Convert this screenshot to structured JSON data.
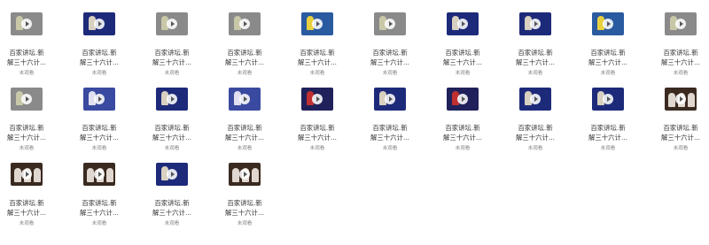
{
  "videos": [
    {
      "title_line1": "百家讲坛.新",
      "title_line2": "解三十六计...",
      "status": "未观看",
      "thumb": "gray"
    },
    {
      "title_line1": "百家讲坛.新",
      "title_line2": "解三十六计...",
      "status": "未观看",
      "thumb": "blue-stage"
    },
    {
      "title_line1": "百家讲坛.新",
      "title_line2": "解三十六计...",
      "status": "未观看",
      "thumb": "gray"
    },
    {
      "title_line1": "百家讲坛.新",
      "title_line2": "解三十六计...",
      "status": "未观看",
      "thumb": "gray"
    },
    {
      "title_line1": "百家讲坛.新",
      "title_line2": "解三十六计...",
      "status": "未观看",
      "thumb": "yellow-stage"
    },
    {
      "title_line1": "百家讲坛.新",
      "title_line2": "解三十六计...",
      "status": "未观看",
      "thumb": "gray"
    },
    {
      "title_line1": "百家讲坛.新",
      "title_line2": "解三十六计...",
      "status": "未观看",
      "thumb": "blue-stage"
    },
    {
      "title_line1": "百家讲坛.新",
      "title_line2": "解三十六计...",
      "status": "未观看",
      "thumb": "blue-stage"
    },
    {
      "title_line1": "百家讲坛.新",
      "title_line2": "解三十六计...",
      "status": "未观看",
      "thumb": "yellow-stage"
    },
    {
      "title_line1": "百家讲坛.新",
      "title_line2": "解三十六计...",
      "status": "未观看",
      "thumb": "gray"
    },
    {
      "title_line1": "百家讲坛.新",
      "title_line2": "解三十六计...",
      "status": "未观看",
      "thumb": "gray"
    },
    {
      "title_line1": "百家讲坛.新",
      "title_line2": "解三十六计...",
      "status": "未观看",
      "thumb": "pattern-stage"
    },
    {
      "title_line1": "百家讲坛.新",
      "title_line2": "解三十六计...",
      "status": "未观看",
      "thumb": "blue-stage"
    },
    {
      "title_line1": "百家讲坛.新",
      "title_line2": "解三十六计...",
      "status": "未观看",
      "thumb": "pattern-stage"
    },
    {
      "title_line1": "百家讲坛.新",
      "title_line2": "解三十六计...",
      "status": "未观看",
      "thumb": "dark-red-stage"
    },
    {
      "title_line1": "百家讲坛.新",
      "title_line2": "解三十六计...",
      "status": "未观看",
      "thumb": "blue-stage"
    },
    {
      "title_line1": "百家讲坛.新",
      "title_line2": "解三十六计...",
      "status": "未观看",
      "thumb": "dark-red-stage"
    },
    {
      "title_line1": "百家讲坛.新",
      "title_line2": "解三十六计...",
      "status": "未观看",
      "thumb": "blue-stage"
    },
    {
      "title_line1": "百家讲坛.新",
      "title_line2": "解三十六计...",
      "status": "未观看",
      "thumb": "blue-stage"
    },
    {
      "title_line1": "百家讲坛.新",
      "title_line2": "解三十六计...",
      "status": "未观看",
      "thumb": "audience"
    },
    {
      "title_line1": "百家讲坛.新",
      "title_line2": "解三十六计...",
      "status": "未观看",
      "thumb": "audience"
    },
    {
      "title_line1": "百家讲坛.新",
      "title_line2": "解三十六计...",
      "status": "未观看",
      "thumb": "audience"
    },
    {
      "title_line1": "百家讲坛.新",
      "title_line2": "解三十六计...",
      "status": "未观看",
      "thumb": "blue-stage"
    },
    {
      "title_line1": "百家讲坛.新",
      "title_line2": "解三十六计...",
      "status": "未观看",
      "thumb": "audience"
    }
  ],
  "thumb_styles": {
    "gray": {
      "bg": "#8a8a8a",
      "fig": "#c8c8a8"
    },
    "blue-stage": {
      "bg": "#1d2a7a",
      "fig": "#d8d0c0"
    },
    "yellow-stage": {
      "bg": "#2a5aa0",
      "fig": "#e8d040"
    },
    "pattern-stage": {
      "bg": "#3a4aa0",
      "fig": "#e0e0f0"
    },
    "dark-red-stage": {
      "bg": "#20205a",
      "fig": "#c03030"
    },
    "audience": {
      "bg": "#3a2a20",
      "fig": "#e0d8d0"
    }
  }
}
